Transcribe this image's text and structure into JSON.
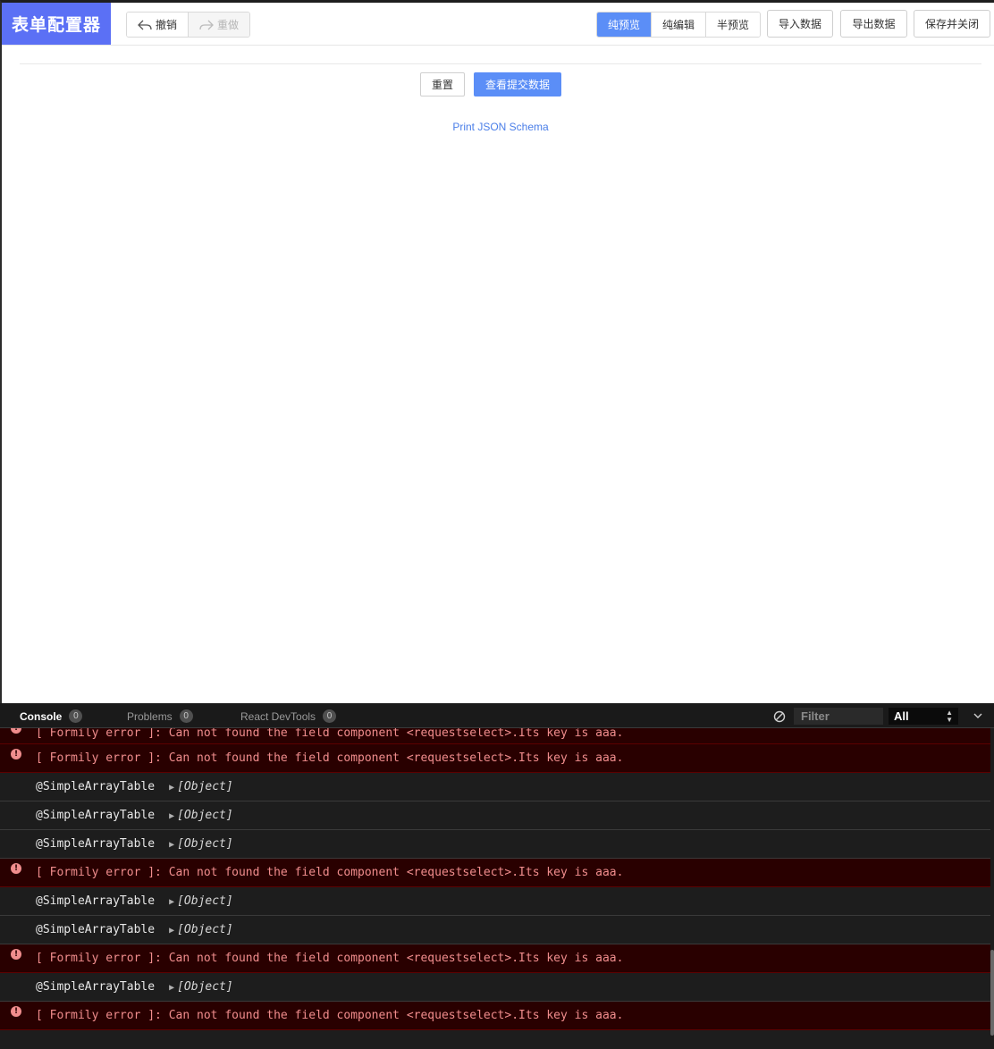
{
  "app": {
    "logo": "表单配置器",
    "history": {
      "undo": "撤销",
      "redo": "重做"
    },
    "view_modes": [
      {
        "label": "纯预览",
        "active": true
      },
      {
        "label": "纯编辑",
        "active": false
      },
      {
        "label": "半预览",
        "active": false
      }
    ],
    "actions": {
      "import": "导入数据",
      "export": "导出数据",
      "save_close": "保存并关闭"
    },
    "form": {
      "reset": "重置",
      "submit": "查看提交数据",
      "print_schema": "Print JSON Schema"
    },
    "colors": {
      "brand": "#5b70f5",
      "primary": "#5b8ef7",
      "link": "#4a7ee8"
    }
  },
  "devtools": {
    "tabs": [
      {
        "label": "Console",
        "count": "0",
        "active": true
      },
      {
        "label": "Problems",
        "count": "0",
        "active": false
      },
      {
        "label": "React DevTools",
        "count": "0",
        "active": false
      }
    ],
    "filter_placeholder": "Filter",
    "level": "All",
    "entries": [
      {
        "type": "error",
        "text": "[ Formily error ]:  Can not found the field component <requestselect>.Its key is aaa."
      },
      {
        "type": "error",
        "text": "[ Formily error ]:  Can not found the field component <requestselect>.Its key is aaa."
      },
      {
        "type": "log",
        "text": "@SimpleArrayTable",
        "object": "[Object]"
      },
      {
        "type": "log",
        "text": "@SimpleArrayTable",
        "object": "[Object]"
      },
      {
        "type": "log",
        "text": "@SimpleArrayTable",
        "object": "[Object]"
      },
      {
        "type": "error",
        "text": "[ Formily error ]:  Can not found the field component <requestselect>.Its key is aaa."
      },
      {
        "type": "log",
        "text": "@SimpleArrayTable",
        "object": "[Object]"
      },
      {
        "type": "log",
        "text": "@SimpleArrayTable",
        "object": "[Object]"
      },
      {
        "type": "error",
        "text": "[ Formily error ]:  Can not found the field component <requestselect>.Its key is aaa."
      },
      {
        "type": "log",
        "text": "@SimpleArrayTable",
        "object": "[Object]"
      },
      {
        "type": "error",
        "text": "[ Formily error ]:  Can not found the field component <requestselect>.Its key is aaa."
      }
    ],
    "icons": {
      "clear": "clear-console-icon",
      "collapse": "chevron-down-icon",
      "error": "error-circle-icon",
      "expand": "triangle-right-icon"
    }
  }
}
